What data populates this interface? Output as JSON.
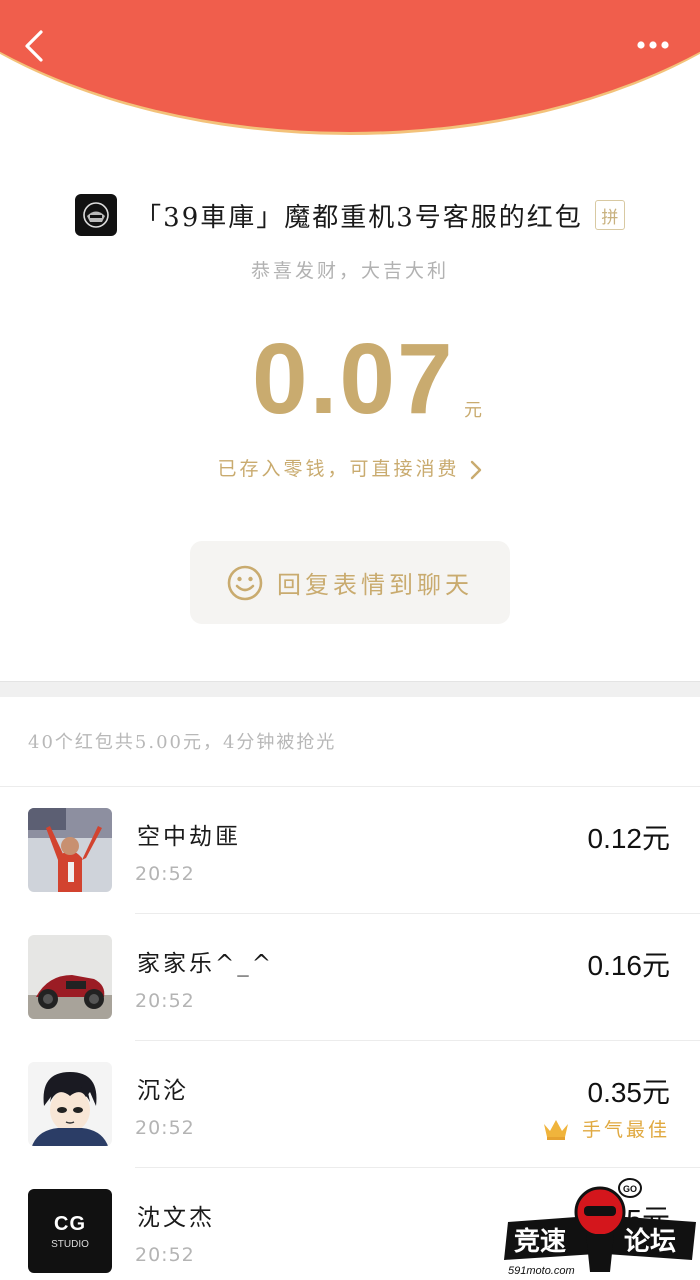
{
  "header": {
    "back_icon": "chevron-left-icon",
    "more_icon": "more-dots-icon",
    "color": "#f05e4c"
  },
  "sender": {
    "name": "「39車庫」魔都重机3号客服的红包",
    "pin_badge": "拼",
    "greeting": "恭喜发财，大吉大利"
  },
  "amount": {
    "value": "0.07",
    "unit": "元"
  },
  "saved_text": "已存入零钱，可直接消费",
  "reply_button": {
    "label": "回复表情到聊天",
    "icon": "smile-icon"
  },
  "summary": "40个红包共5.00元，4分钟被抢光",
  "recipients": [
    {
      "name": "空中劫匪",
      "time": "20:52",
      "amount": "0.12元"
    },
    {
      "name": "家家乐^_^",
      "time": "20:52",
      "amount": "0.16元"
    },
    {
      "name": "沉沦",
      "time": "20:52",
      "amount": "0.35元",
      "best_label": "手气最佳",
      "best_icon": "crown-icon"
    },
    {
      "name": "沈文杰",
      "time": "20:52",
      "amount": "5元",
      "avatar_text": "CG",
      "avatar_sub": "STUDIO"
    }
  ],
  "watermark": {
    "brand_left": "竞速",
    "brand_right": "论坛",
    "url": "591moto.com",
    "bubble": "GO"
  },
  "colors": {
    "gold": "#c9ab6f",
    "crown": "#e0a940",
    "red": "#f05e4c"
  }
}
